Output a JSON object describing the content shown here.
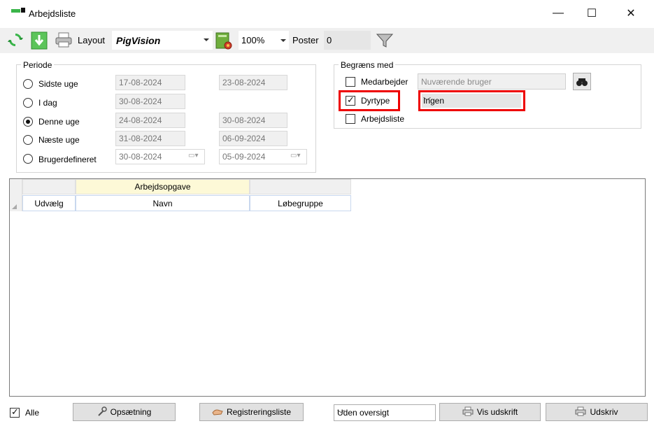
{
  "window": {
    "title": "Arbejdsliste",
    "controls": {
      "minimize": "—",
      "maximize": "☐",
      "close": "✕"
    }
  },
  "toolbar": {
    "icons": [
      "refresh-icon",
      "download-icon",
      "printer-icon",
      "layout-settings-icon",
      "filter-icon"
    ],
    "layout_label": "Layout",
    "layout_value": "PigVision",
    "zoom_value": "100%",
    "poster_label": "Poster",
    "poster_value": "0"
  },
  "periode": {
    "title": "Periode",
    "options": [
      {
        "label": "Sidste uge",
        "from": "17-08-2024",
        "to": "23-08-2024",
        "selected": false
      },
      {
        "label": "I dag",
        "from": "30-08-2024",
        "to": "",
        "selected": false
      },
      {
        "label": "Denne uge",
        "from": "24-08-2024",
        "to": "30-08-2024",
        "selected": true
      },
      {
        "label": "Næste uge",
        "from": "31-08-2024",
        "to": "06-09-2024",
        "selected": false
      },
      {
        "label": "Brugerdefineret",
        "from": "30-08-2024",
        "to": "05-09-2024",
        "selected": false
      }
    ]
  },
  "begraens": {
    "title": "Begræns med",
    "medarbejder": {
      "label": "Medarbejder",
      "checked": false,
      "value": "Nuværende bruger"
    },
    "dyrtype": {
      "label": "Dyrtype",
      "checked": true,
      "value": "Ingen"
    },
    "arbejdsliste": {
      "label": "Arbejdsliste",
      "checked": false
    }
  },
  "grid": {
    "band_header": "Arbejdsopgave",
    "columns": [
      "Udvælg",
      "Navn",
      "Løbegruppe"
    ],
    "rows": []
  },
  "bottom": {
    "alle_label": "Alle",
    "alle_checked": true,
    "opsaetning": "Opsætning",
    "registreringsliste": "Registreringsliste",
    "oversigt_value": "Uden oversigt",
    "vis_udskrift": "Vis udskrift",
    "udskriv": "Udskriv"
  },
  "colors": {
    "highlight_red": "#ee0000",
    "band_yellow": "#fdf9d7",
    "toolbar_bg": "#f0f0f0",
    "refresh_green": "#3ab54a"
  }
}
